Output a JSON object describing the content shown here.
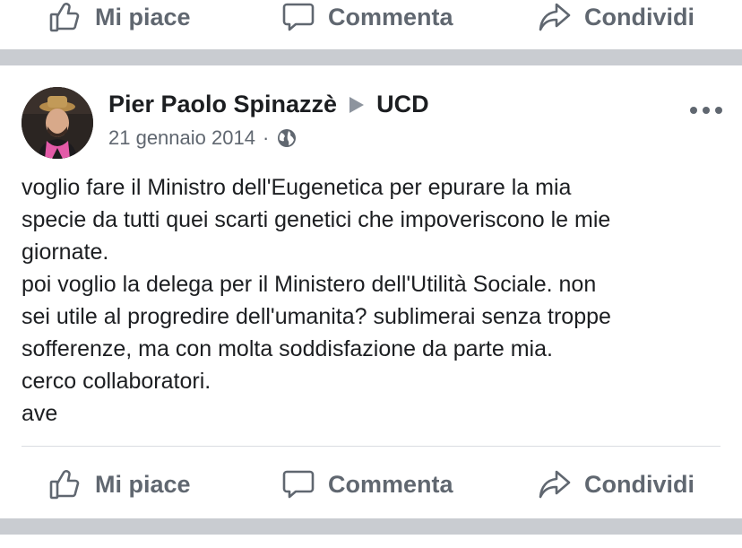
{
  "actions": {
    "like": "Mi piace",
    "comment": "Commenta",
    "share": "Condividi"
  },
  "post": {
    "author": "Pier Paolo Spinazzè",
    "group": "UCD",
    "date": "21 gennaio 2014",
    "separator_dot": "·",
    "privacy_icon": "globe-icon",
    "lines": [
      "voglio fare il Ministro dell'Eugenetica per epurare la mia",
      "specie da tutti quei scarti genetici che impoveriscono le mie",
      "giornate.",
      "poi voglio la delega per il Ministero dell'Utilità Sociale. non",
      "sei utile al progredire dell'umanita? sublimerai senza troppe",
      "sofferenze, ma con molta soddisfazione da parte mia.",
      "cerco collaboratori.",
      "ave"
    ]
  },
  "colors": {
    "text": "#1c1e21",
    "secondary": "#606770",
    "separator": "#c9ccd1"
  }
}
